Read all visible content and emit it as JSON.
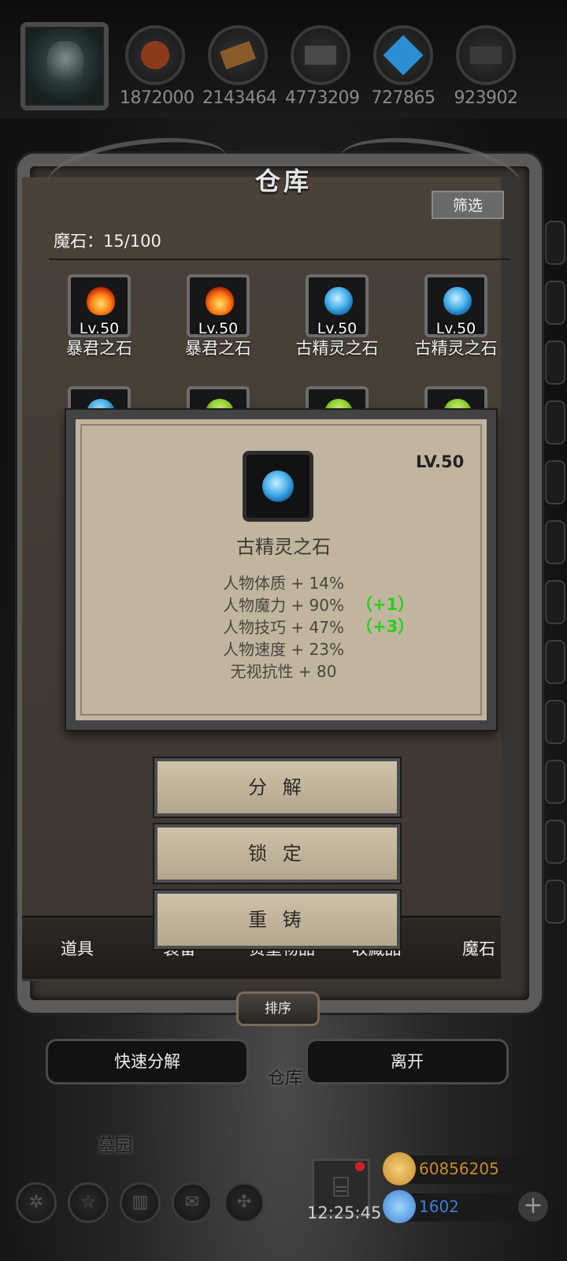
{
  "resources": [
    {
      "icon": "meat-icon",
      "value": "1872000"
    },
    {
      "icon": "wood-icon",
      "value": "2143464"
    },
    {
      "icon": "iron-icon",
      "value": "4773209"
    },
    {
      "icon": "crystal-icon",
      "value": "727865"
    },
    {
      "icon": "ingot-icon",
      "value": "923902"
    }
  ],
  "panel": {
    "title": "仓库",
    "filter_label": "筛选",
    "count_text": "魔石：15/100",
    "sort_label": "排序"
  },
  "items": [
    {
      "level": "Lv.50",
      "name": "暴君之石",
      "type": "fire"
    },
    {
      "level": "Lv.50",
      "name": "暴君之石",
      "type": "fire"
    },
    {
      "level": "Lv.50",
      "name": "古精灵之石",
      "type": "ice"
    },
    {
      "level": "Lv.50",
      "name": "古精灵之石",
      "type": "ice"
    },
    {
      "type": "ice"
    },
    {
      "type": "leaf"
    },
    {
      "type": "leaf"
    },
    {
      "type": "leaf"
    }
  ],
  "tabs": [
    "道具",
    "装备",
    "贵重物品",
    "收藏品",
    "魔石"
  ],
  "popup": {
    "level": "LV.50",
    "name": "古精灵之石",
    "stats": [
      "人物体质 + 14%",
      "人物魔力 + 90%",
      "人物技巧 + 47%",
      "人物速度 + 23%",
      "无视抗性 + 80"
    ],
    "bonus_magic": "（+1）",
    "bonus_skill": "（+3）"
  },
  "actions": [
    "分 解",
    "锁 定",
    "重 铸"
  ],
  "footer": {
    "quick_decompose": "快速分解",
    "leave": "离开",
    "place_warehouse": "仓库",
    "place_graveyard": "墓园",
    "clock": "12:25:45",
    "gold": "60856205",
    "gems": "1602",
    "gold_color": "#c98a2a",
    "gem_color": "#3d7fd1"
  }
}
